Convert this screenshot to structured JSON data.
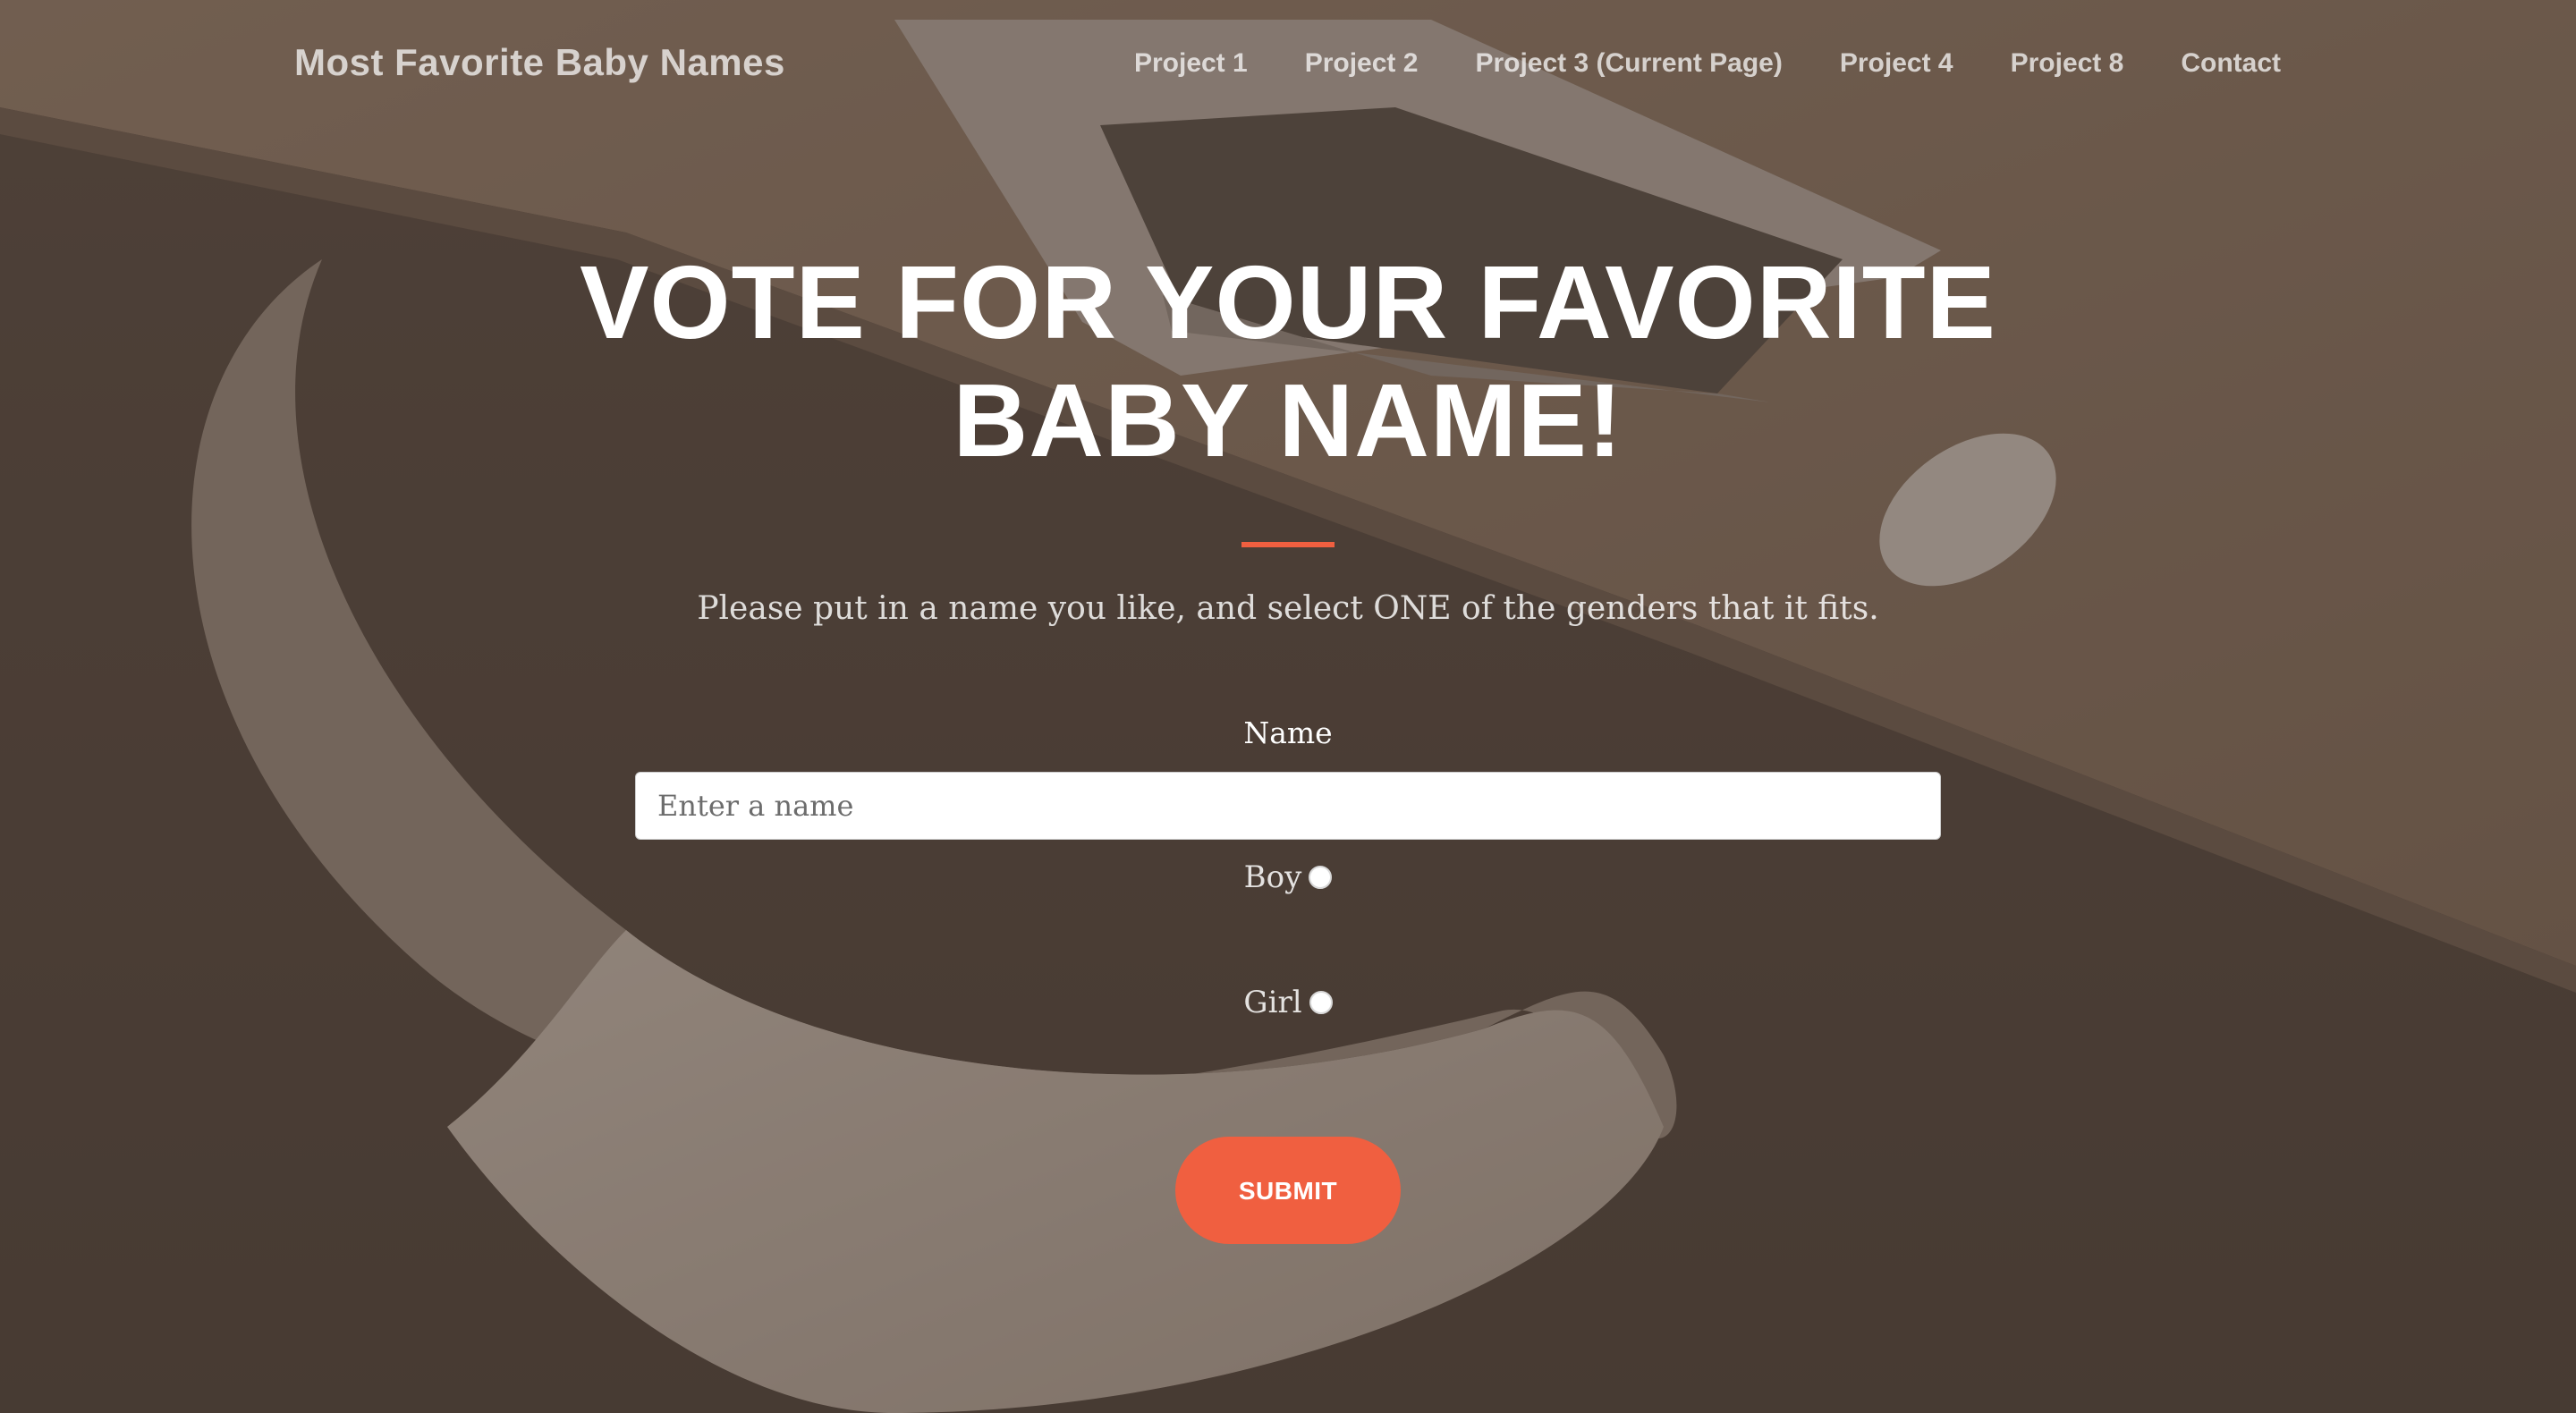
{
  "nav": {
    "brand": "Most Favorite Baby Names",
    "links": [
      "Project 1",
      "Project 2",
      "Project 3 (Current Page)",
      "Project 4",
      "Project 8",
      "Contact"
    ]
  },
  "hero": {
    "title": "VOTE FOR YOUR FAVORITE BABY NAME!",
    "subtitle": "Please put in a name you like, and select ONE of the genders that it fits."
  },
  "form": {
    "name_label": "Name",
    "name_placeholder": "Enter a name",
    "name_value": "",
    "options": [
      "Boy",
      "Girl"
    ],
    "submit_label": "SUBMIT"
  },
  "colors": {
    "accent": "#f05f40",
    "overlay": "#5c4d42",
    "text": "#ffffff"
  }
}
